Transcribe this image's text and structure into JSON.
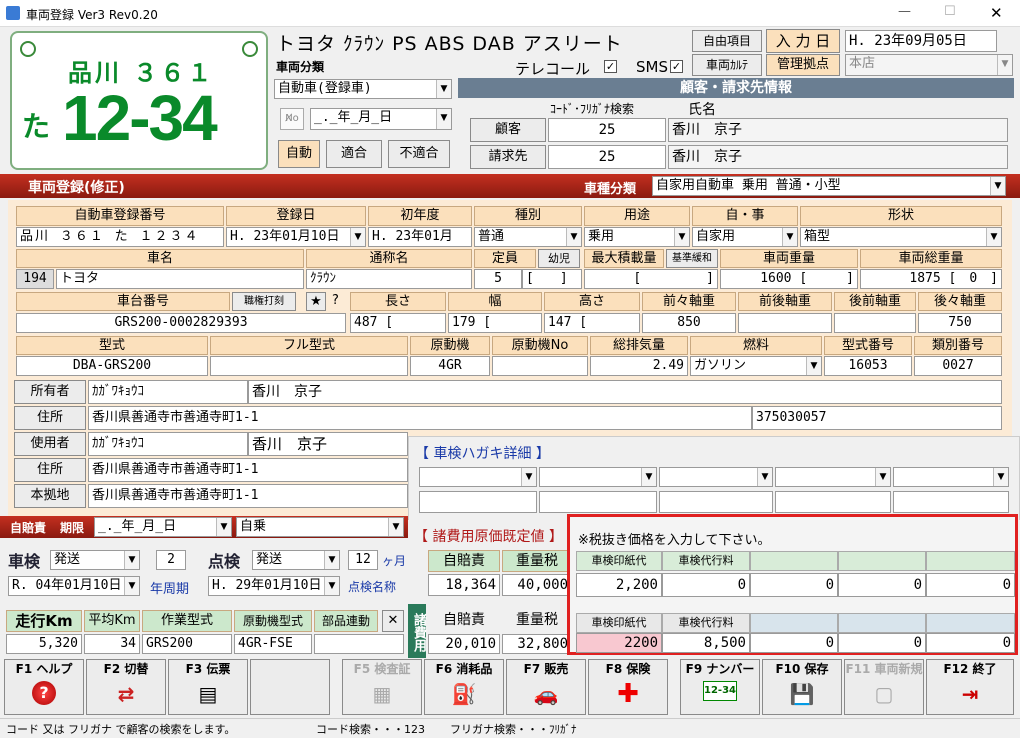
{
  "window": {
    "title": "車両登録 Ver3 Rev0.20",
    "minimize": "—",
    "maximize": "☐",
    "close": "✕"
  },
  "plate": {
    "region": "品川 ３６１",
    "kana": "た",
    "number": "12-34"
  },
  "vehicle_title": "トヨタ ｸﾗｳﾝ PS ABS DAB アスリート",
  "top_buttons": {
    "free_item": "自由項目",
    "input_date_label": "入 力 日",
    "input_date": "H. 23年09月05日",
    "vehicle_karte": "車両ｶﾙﾃ",
    "mgmt_base_label": "管理拠点",
    "mgmt_base": "本店"
  },
  "vehicle_class": {
    "label": "車両分類",
    "value": "自動車(登録車)",
    "no_date": "_._年_月_日",
    "btn_auto": "自動",
    "btn_ok": "適合",
    "btn_ng": "不適合"
  },
  "telecall": {
    "label": "テレコール",
    "check": "✓",
    "sms_label": "SMS",
    "sms_check": "✓"
  },
  "customer": {
    "section_title": "顧客・請求先情報",
    "code_header": "ｺｰﾄﾞ･ﾌﾘｶﾞﾅ検索",
    "name_header": "氏名",
    "customer_btn": "顧客",
    "customer_code": "25",
    "customer_name": "香川　京子",
    "billing_btn": "請求先",
    "billing_code": "25",
    "billing_name": "香川　京子"
  },
  "bar": {
    "title": "車両登録(修正)",
    "type_label": "車種分類",
    "type_value": "自家用自動車 乗用 普通・小型"
  },
  "headers1": [
    "自動車登録番号",
    "登録日",
    "初年度",
    "種別",
    "用途",
    "自・事",
    "形状"
  ],
  "row1": {
    "reg_no": "品川 ３６１ た １２３４",
    "reg_date": "H. 23年01月10日",
    "first_year": "H. 23年01月",
    "kind": "普通",
    "use": "乗用",
    "jiji": "自家用",
    "shape": "箱型"
  },
  "headers2": {
    "car_name": "車名",
    "common_name": "通称名",
    "capacity": "定員",
    "youji": "幼児",
    "max_load": "最大積載量",
    "std_relax": "基準緩和",
    "weight": "車両重量",
    "gross": "車両総重量"
  },
  "row2": {
    "maker_code": "194",
    "maker": "トヨタ",
    "common": "ｸﾗｳﾝ",
    "capacity": "5",
    "cap_sub": "[　　]",
    "max_load": "[　　　　　]",
    "weight": "1600 [　　　]",
    "gross": "1875 [　0　]"
  },
  "headers3": {
    "chassis": "車台番号",
    "stamp": "職権打刻",
    "star": "★",
    "q": "?",
    "length": "長さ",
    "width": "幅",
    "height": "高さ",
    "ff_axle": "前々軸重",
    "fr_axle": "前後軸重",
    "rf_axle": "後前軸重",
    "rr_axle": "後々軸重"
  },
  "row3": {
    "chassis": "GRS200-0002829393",
    "length": "487 [",
    "width": "179 [",
    "height": "147 [",
    "ff_axle": "850",
    "rr_axle": "750"
  },
  "headers4": {
    "model": "型式",
    "full_model": "フル型式",
    "engine": "原動機",
    "engine_no": "原動機No",
    "displacement": "総排気量",
    "fuel": "燃料",
    "model_no": "型式番号",
    "class_no": "類別番号"
  },
  "row4": {
    "model": "DBA-GRS200",
    "engine": "4GR",
    "displacement": "2.49",
    "fuel": "ガソリン",
    "model_no": "16053",
    "class_no": "0027"
  },
  "persons": [
    {
      "btn": "所有者",
      "kana": "ｶｶﾞﾜｷｮｳｺ",
      "name": "香川　京子"
    },
    {
      "btn": "住所",
      "address": "香川県善通寺市善通寺町1-1",
      "zip": "375030057"
    },
    {
      "btn": "使用者",
      "kana": "ｶｶﾞﾜｷｮｳｺ",
      "name": "香川　京子"
    },
    {
      "btn": "住所",
      "address": "香川県善通寺市善通寺町1-1"
    },
    {
      "btn": "本拠地",
      "address": "香川県善通寺市善通寺町1-1"
    }
  ],
  "hagaki": {
    "title": "【 車検ハガキ詳細 】"
  },
  "jibaiseki": {
    "label": "自賠責",
    "period_label": "期限",
    "date": "_._年_月_日",
    "type": "自乗"
  },
  "shaken": {
    "label": "車検",
    "type": "発送",
    "years": "2",
    "years_label": "年周期",
    "date": "R. 04年01月10日",
    "tenken_label": "点検",
    "tenken_type": "発送",
    "months": "12",
    "months_label": "ヶ月",
    "tenken_date": "H. 29年01月10日",
    "tenken_name": "点検名称"
  },
  "mileage": {
    "label": "走行Km",
    "value": "5,320",
    "avg_label": "平均Km",
    "avg": "34",
    "work_model_label": "作業型式",
    "work_model": "GRS200",
    "engine_model_label": "原動機型式",
    "engine_model": "4GR-FSE",
    "parts_label": "部品連動",
    "x": "✕"
  },
  "costs": {
    "title": "【 諸費用原価既定値 】",
    "note": "※税抜き価格を入力して下さい。",
    "shohiyo": "諸費用",
    "h1": "自賠責",
    "h2": "重量税",
    "h3": "車検印紙代",
    "h4": "車検代行料",
    "r1": [
      "18,364",
      "40,000",
      "2,200",
      "0",
      "0",
      "0",
      "0"
    ],
    "r2": [
      "20,010",
      "32,800",
      "2200",
      "8,500",
      "0",
      "0",
      "0"
    ]
  },
  "fkeys": [
    {
      "key": "F1",
      "label": "ヘルプ",
      "icon": "help-icon",
      "glyph": "?"
    },
    {
      "key": "F2",
      "label": "切替",
      "icon": "switch-icon",
      "glyph": "⇄"
    },
    {
      "key": "F3",
      "label": "伝票",
      "icon": "document-icon",
      "glyph": "▤"
    },
    {
      "key": "",
      "label": "",
      "icon": "blank-icon",
      "glyph": ""
    },
    {
      "key": "F5",
      "label": "検査証",
      "icon": "certificate-icon",
      "glyph": "▦"
    },
    {
      "key": "F6",
      "label": "消耗品",
      "icon": "oil-can-icon",
      "glyph": "⛽"
    },
    {
      "key": "F7",
      "label": "販売",
      "icon": "car-icon",
      "glyph": "🚗"
    },
    {
      "key": "F8",
      "label": "保険",
      "icon": "red-cross-icon",
      "glyph": "✚"
    },
    {
      "key": "F9",
      "label": "ナンバー",
      "icon": "plate-icon",
      "glyph": "12-34"
    },
    {
      "key": "F10",
      "label": "保存",
      "icon": "save-icon",
      "glyph": "💾"
    },
    {
      "key": "F11",
      "label": "車両新規",
      "icon": "new-vehicle-icon",
      "glyph": "▢"
    },
    {
      "key": "F12",
      "label": "終了",
      "icon": "exit-icon",
      "glyph": "⇥"
    }
  ],
  "status": {
    "text1": "コード 又は フリガナ で顧客の検索をします。",
    "text2": "コード検索・・・123",
    "text3": "フリガナ検索・・・ﾌﾘｶﾞﾅ"
  }
}
